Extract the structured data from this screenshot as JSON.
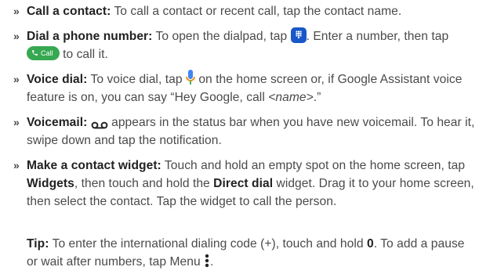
{
  "bullet_glyph": "»",
  "items": [
    {
      "term": "Call a contact:",
      "text": " To call a contact or recent call, tap the contact name."
    },
    {
      "term": "Dial a phone number:",
      "text_before_icon": " To open the dialpad, tap ",
      "icon": "dialpad-icon",
      "text_after_icon": ". Enter a number, then tap ",
      "button_label": "Call",
      "text_end": " to call it."
    },
    {
      "term": "Voice dial:",
      "text_before_icon": " To voice dial, tap ",
      "icon": "microphone-icon",
      "text_after_icon": " on the home screen or, if Google Assistant voice feature is on, you can say “Hey Google, call ",
      "placeholder": "<name>",
      "text_end": ".”"
    },
    {
      "term": "Voicemail:",
      "icon": "voicemail-icon",
      "text_after_icon": " appears in the status bar when you have new voicemail. To hear it, swipe down and tap the notification."
    },
    {
      "term": "Make a contact widget:",
      "text_1": " Touch and hold an empty spot on the home screen, tap ",
      "bold_1": "Widgets",
      "text_2": ", then touch and hold the ",
      "bold_2": "Direct dial",
      "text_3": " widget. Drag it to your home screen, then select the contact. Tap the widget to call the person."
    }
  ],
  "tip": {
    "term": "Tip:",
    "text_1": " To enter the international dialing code (+), touch and hold ",
    "bold_1": "0",
    "text_2": ". To add a pause or wait after numbers, tap Menu ",
    "icon": "menu-icon",
    "text_end": "."
  },
  "colors": {
    "text": "#4a4a4a",
    "bold": "#222222",
    "dialpad_icon_bg": "#1a57c9",
    "call_button_bg": "#36a852",
    "mic_blue": "#4285f4",
    "mic_stand": "#ea8f00"
  }
}
